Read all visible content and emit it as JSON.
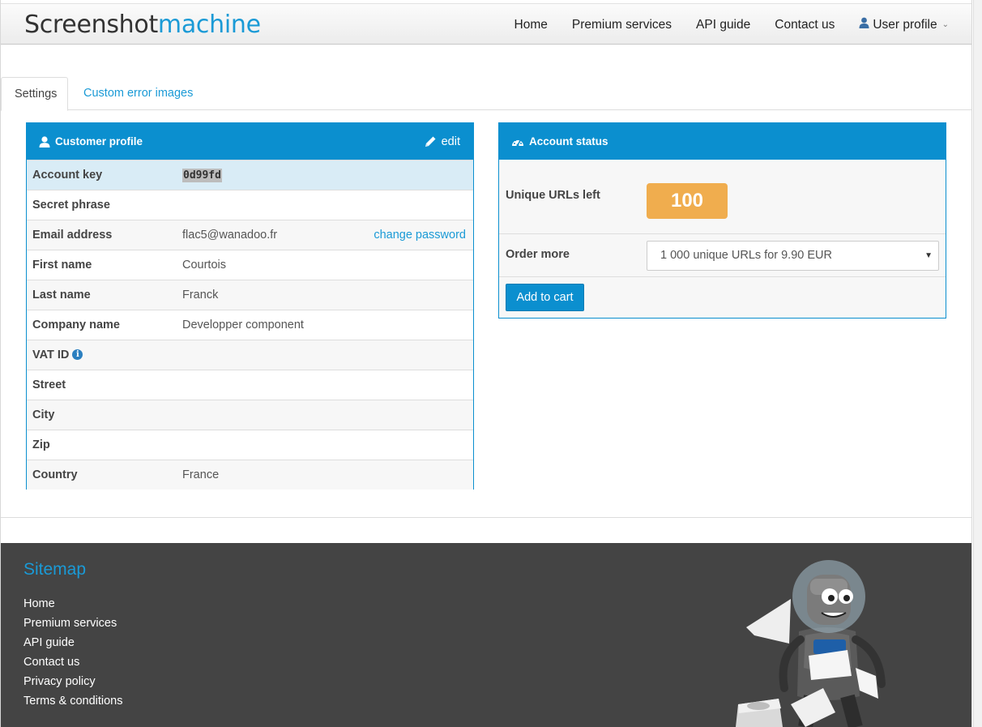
{
  "brand": {
    "part1": "Screenshot",
    "part2": "machine"
  },
  "nav": {
    "items": [
      "Home",
      "Premium services",
      "API guide",
      "Contact us"
    ],
    "user_profile": "User profile"
  },
  "tabs": {
    "settings": "Settings",
    "custom_errors": "Custom error images"
  },
  "profile": {
    "title": "Customer profile",
    "edit": "edit",
    "rows": [
      {
        "label": "Account key",
        "value": "0d99fd",
        "action": ""
      },
      {
        "label": "Secret phrase",
        "value": "",
        "action": ""
      },
      {
        "label": "Email address",
        "value": "flac5@wanadoo.fr",
        "action": "change password"
      },
      {
        "label": "First name",
        "value": "Courtois",
        "action": ""
      },
      {
        "label": "Last name",
        "value": "Franck",
        "action": ""
      },
      {
        "label": "Company name",
        "value": "Developper component",
        "action": ""
      },
      {
        "label": "VAT ID",
        "value": "",
        "action": ""
      },
      {
        "label": "Street",
        "value": "",
        "action": ""
      },
      {
        "label": "City",
        "value": "",
        "action": ""
      },
      {
        "label": "Zip",
        "value": "",
        "action": ""
      },
      {
        "label": "Country",
        "value": "France",
        "action": ""
      }
    ]
  },
  "status": {
    "title": "Account status",
    "urls_label": "Unique URLs left",
    "urls_count": "100",
    "order_label": "Order more",
    "order_selected": "1 000 unique URLs for 9.90 EUR",
    "add_to_cart": "Add to cart"
  },
  "footer": {
    "sitemap_title": "Sitemap",
    "links": [
      "Home",
      "Premium services",
      "API guide",
      "Contact us",
      "Privacy policy",
      "Terms & conditions"
    ]
  },
  "icons": {
    "user": "user-icon",
    "pencil": "pencil-icon",
    "dashboard": "dashboard-icon",
    "info": "info-icon",
    "chevron": "chevron-down-icon"
  },
  "colors": {
    "accent": "#0b8fcf",
    "link": "#1a9ad6",
    "badge": "#f0ad4e",
    "footer_bg": "#444444",
    "row_highlight": "#d9ecf6"
  }
}
